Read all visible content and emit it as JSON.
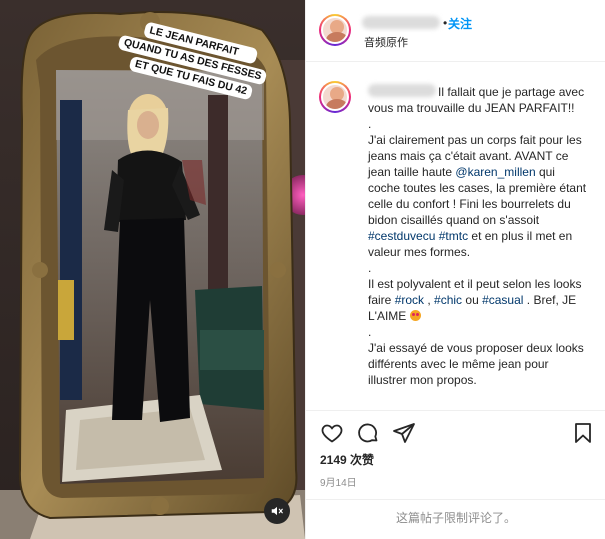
{
  "media": {
    "sticker_lines": [
      "LE JEAN PARFAIT",
      "QUAND TU AS DES FESSES",
      "ET QUE TU FAIS DU 42"
    ],
    "mute_icon": "speaker-muted-icon"
  },
  "header": {
    "dot": "•",
    "follow_label": "关注",
    "audio_label": "音频原作"
  },
  "caption": {
    "intro": "Il fallait que je partage avec vous ma trouvaille du JEAN PARFAIT!!",
    "sep1": ".",
    "p1_a": "J'ai clairement pas un corps fait pour les jeans mais ça c'était avant. AVANT ce jean taille haute ",
    "mention": "@karen_millen",
    "p1_b": " qui coche toutes les cases, la première étant celle du confort ! Fini les bourrelets du bidon cisaillés quand on s'assoit ",
    "tag1": "#cestduvecu",
    "tag2": "#tmtc",
    "p1_c": " et en plus il met en valeur mes formes.",
    "sep2": ".",
    "p2_a": "Il est polyvalent et il peut selon les looks faire ",
    "tag3": "#rock",
    "p2_b": " , ",
    "tag4": "#chic",
    "p2_c": " ou ",
    "tag5": "#casual",
    "p2_d": " . Bref, JE L'AIME ",
    "sep3": ".",
    "p3": "J'ai essayé de vous proposer deux looks différents avec le même jean pour illustrer mon propos."
  },
  "actions": {
    "icons": [
      "heart-icon",
      "comment-icon",
      "share-icon",
      "bookmark-icon"
    ],
    "likes": "2149 次赞",
    "date": "9月14日",
    "comments_limited": "这篇帖子限制评论了。"
  },
  "colors": {
    "link": "#0095f6",
    "hashtag": "#00376b",
    "muted_text": "#8e8e8e",
    "divider": "#efefef"
  }
}
